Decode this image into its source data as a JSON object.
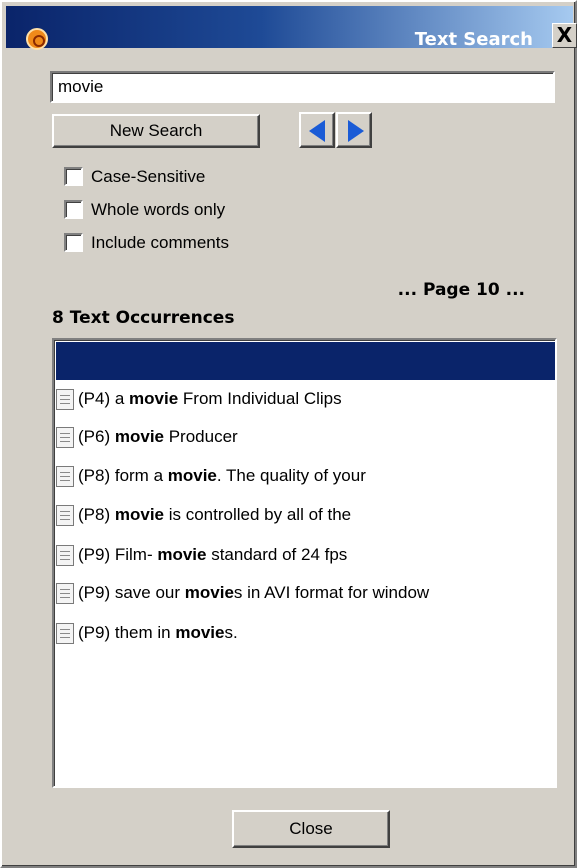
{
  "window": {
    "title": "Text Search",
    "close_glyph": "X",
    "app_icon": "app-logo-icon"
  },
  "search": {
    "query": "movie",
    "new_search_label": "New Search",
    "prev_icon": "arrow-left-icon",
    "next_icon": "arrow-right-icon"
  },
  "options": {
    "case_sensitive": {
      "label": "Case-Sensitive",
      "checked": false
    },
    "whole_words": {
      "label": "Whole words only",
      "checked": false
    },
    "include_comments": {
      "label": "Include comments",
      "checked": false
    }
  },
  "status": {
    "page_label": "... Page 10 ...",
    "occurrences_label": "8 Text Occurrences"
  },
  "results": {
    "header": "",
    "items": [
      {
        "page": "(P4)",
        "before": " a ",
        "match": "movie",
        "after": " From Individual Clips"
      },
      {
        "page": "(P6)",
        "before": " ",
        "match": "movie",
        "after": " Producer"
      },
      {
        "page": "(P8)",
        "before": " form a ",
        "match": "movie",
        "after": ". The quality of your"
      },
      {
        "page": "(P8)",
        "before": " ",
        "match": "movie",
        "after": " is controlled by all of the"
      },
      {
        "page": "(P9)",
        "before": " Film- ",
        "match": "movie",
        "after": " standard of 24 fps"
      },
      {
        "page": "(P9)",
        "before": " save our ",
        "match": "movie",
        "after": "s in AVI format for window"
      },
      {
        "page": "(P9)",
        "before": " them in ",
        "match": "movie",
        "after": "s."
      }
    ]
  },
  "footer": {
    "close_label": "Close"
  },
  "colors": {
    "title_gradient_start": "#0a246a",
    "title_gradient_end": "#a6caf0",
    "selection": "#0a246a",
    "arrow": "#1a5bd6",
    "dialog_bg": "#d4d0c8"
  }
}
